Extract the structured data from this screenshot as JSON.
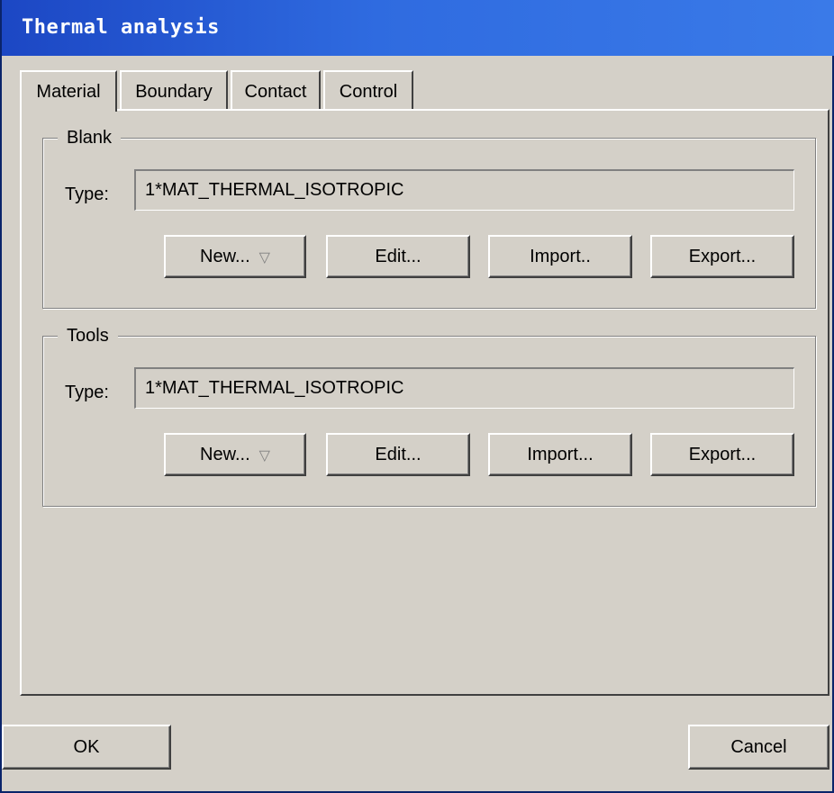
{
  "window": {
    "title": "Thermal analysis"
  },
  "tabs": [
    {
      "label": "Material",
      "active": true
    },
    {
      "label": "Boundary",
      "active": false
    },
    {
      "label": "Contact",
      "active": false
    },
    {
      "label": "Control",
      "active": false
    }
  ],
  "blank": {
    "legend": "Blank",
    "type_label": "Type:",
    "type_value": "1*MAT_THERMAL_ISOTROPIC",
    "buttons": {
      "new": "New...",
      "edit": "Edit...",
      "import": "Import..",
      "export": "Export..."
    }
  },
  "tools": {
    "legend": "Tools",
    "type_label": "Type:",
    "type_value": "1*MAT_THERMAL_ISOTROPIC",
    "buttons": {
      "new": "New...",
      "edit": "Edit...",
      "import": "Import...",
      "export": "Export..."
    }
  },
  "footer": {
    "ok": "OK",
    "cancel": "Cancel"
  },
  "icons": {
    "dropdown": "dropdown-triangle-icon"
  },
  "colors": {
    "titlebar": "#2f6be0",
    "face": "#d4d0c8"
  }
}
